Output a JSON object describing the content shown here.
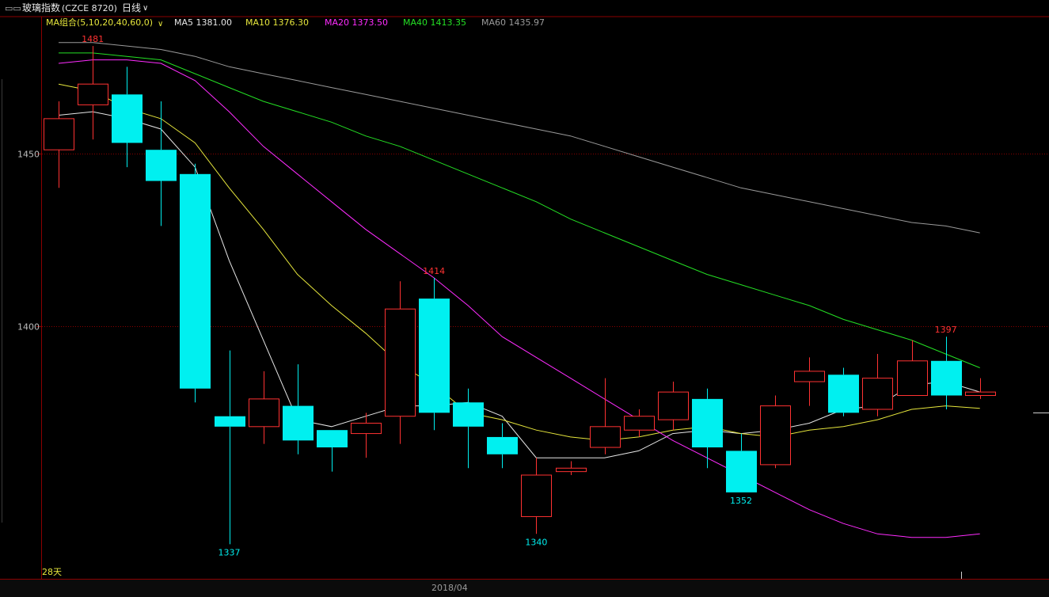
{
  "window": {
    "title_icon": "window-icon",
    "title": "玻璃指数",
    "code": "(CZCE 8720)",
    "period": "日线",
    "period_icon": "chevron-down-icon"
  },
  "ma_legend": {
    "group_label": "MA组合(5,10,20,40,60,0)",
    "group_icon": "chevron-down-icon",
    "items": [
      {
        "label": "MA5 1381.00",
        "color": "#e6e6e6"
      },
      {
        "label": "MA10 1376.30",
        "color": "#e6e63c"
      },
      {
        "label": "MA20 1373.50",
        "color": "#ff2cff"
      },
      {
        "label": "MA40 1413.35",
        "color": "#24e024"
      },
      {
        "label": "MA60 1435.97",
        "color": "#9a9a9a"
      }
    ]
  },
  "chart_data": {
    "type": "candlestick",
    "ylim": [
      1330,
      1484
    ],
    "y_ticks": [
      1450,
      1400
    ],
    "y_tick_labels": [
      "1450",
      "1400"
    ],
    "x_tick_labels": [
      "2018/04"
    ],
    "period_count_label": "28天",
    "colors": {
      "up": "#ff3232",
      "down": "#00f0f0",
      "grid": "#8b0000"
    },
    "candles": [
      {
        "open": 1451,
        "close": 1460,
        "high": 1465,
        "low": 1440
      },
      {
        "open": 1464,
        "close": 1470,
        "high": 1481,
        "low": 1454
      },
      {
        "open": 1467,
        "close": 1453,
        "high": 1475,
        "low": 1446
      },
      {
        "open": 1451,
        "close": 1442,
        "high": 1465,
        "low": 1429
      },
      {
        "open": 1444,
        "close": 1382,
        "high": 1447,
        "low": 1378
      },
      {
        "open": 1374,
        "close": 1371,
        "high": 1393,
        "low": 1337
      },
      {
        "open": 1371,
        "close": 1379,
        "high": 1387,
        "low": 1366
      },
      {
        "open": 1377,
        "close": 1367,
        "high": 1389,
        "low": 1363
      },
      {
        "open": 1370,
        "close": 1365,
        "high": 1370,
        "low": 1358
      },
      {
        "open": 1369,
        "close": 1372,
        "high": 1375,
        "low": 1362
      },
      {
        "open": 1374,
        "close": 1405,
        "high": 1413,
        "low": 1366
      },
      {
        "open": 1408,
        "close": 1375,
        "high": 1414,
        "low": 1370
      },
      {
        "open": 1378,
        "close": 1371,
        "high": 1382,
        "low": 1359
      },
      {
        "open": 1368,
        "close": 1363,
        "high": 1372,
        "low": 1359
      },
      {
        "open": 1345,
        "close": 1357,
        "high": 1362,
        "low": 1340
      },
      {
        "open": 1358,
        "close": 1359,
        "high": 1361,
        "low": 1357
      },
      {
        "open": 1365,
        "close": 1371,
        "high": 1385,
        "low": 1363
      },
      {
        "open": 1370,
        "close": 1374,
        "high": 1376,
        "low": 1368
      },
      {
        "open": 1373,
        "close": 1381,
        "high": 1384,
        "low": 1370
      },
      {
        "open": 1379,
        "close": 1365,
        "high": 1382,
        "low": 1359
      },
      {
        "open": 1364,
        "close": 1352,
        "high": 1369,
        "low": 1352
      },
      {
        "open": 1360,
        "close": 1377,
        "high": 1380,
        "low": 1359
      },
      {
        "open": 1384,
        "close": 1387,
        "high": 1391,
        "low": 1377
      },
      {
        "open": 1386,
        "close": 1375,
        "high": 1388,
        "low": 1374
      },
      {
        "open": 1376,
        "close": 1385,
        "high": 1392,
        "low": 1374
      },
      {
        "open": 1380,
        "close": 1390,
        "high": 1396,
        "low": 1380
      },
      {
        "open": 1390,
        "close": 1380,
        "high": 1397,
        "low": 1376
      },
      {
        "open": 1380,
        "close": 1381,
        "high": 1385,
        "low": 1379
      }
    ],
    "annotations": [
      {
        "index": 1,
        "value": 1481,
        "label": "1481",
        "pos": "above",
        "color": "#ff3232"
      },
      {
        "index": 5,
        "value": 1337,
        "label": "1337",
        "pos": "below",
        "color": "#00f0f0"
      },
      {
        "index": 11,
        "value": 1414,
        "label": "1414",
        "pos": "above",
        "color": "#ff3232"
      },
      {
        "index": 14,
        "value": 1340,
        "label": "1340",
        "pos": "below",
        "color": "#00f0f0"
      },
      {
        "index": 20,
        "value": 1352,
        "label": "1352",
        "pos": "below",
        "color": "#00f0f0"
      },
      {
        "index": 26,
        "value": 1397,
        "label": "1397",
        "pos": "above",
        "color": "#ff3232"
      }
    ],
    "series": [
      {
        "name": "MA5",
        "color": "#e6e6e6",
        "values": [
          1461,
          1462,
          1460,
          1457,
          1446,
          1419,
          1396,
          1373,
          1371,
          1374,
          1377,
          1377,
          1378,
          1374,
          1362,
          1362,
          1362,
          1364,
          1369,
          1370,
          1369,
          1370,
          1372,
          1376,
          1377,
          1383,
          1384,
          1381
        ]
      },
      {
        "name": "MA10",
        "color": "#e6e63c",
        "values": [
          1470,
          1468,
          1463,
          1460,
          1453,
          1440,
          1428,
          1415,
          1406,
          1398,
          1389,
          1383,
          1375,
          1373,
          1370,
          1368,
          1367,
          1368,
          1370,
          1371,
          1369,
          1368,
          1370,
          1371,
          1373,
          1376,
          1377,
          1376.3
        ]
      },
      {
        "name": "MA20",
        "color": "#ff2cff",
        "values": [
          1476,
          1477,
          1477,
          1476,
          1471,
          1462,
          1452,
          1444,
          1436,
          1428,
          1421,
          1414,
          1406,
          1397,
          1391,
          1385,
          1379,
          1373,
          1367,
          1362,
          1357,
          1352,
          1347,
          1343,
          1340,
          1339,
          1339,
          1340
        ]
      },
      {
        "name": "MA40",
        "color": "#24e024",
        "values": [
          1479,
          1479,
          1478,
          1477,
          1473,
          1469,
          1465,
          1462,
          1459,
          1455,
          1452,
          1448,
          1444,
          1440,
          1436,
          1431,
          1427,
          1423,
          1419,
          1415,
          1412,
          1409,
          1406,
          1402,
          1399,
          1396,
          1392,
          1388
        ]
      },
      {
        "name": "MA60",
        "color": "#9a9a9a",
        "values": [
          1482,
          1482,
          1481,
          1480,
          1478,
          1475,
          1473,
          1471,
          1469,
          1467,
          1465,
          1463,
          1461,
          1459,
          1457,
          1455,
          1452,
          1449,
          1446,
          1443,
          1440,
          1438,
          1436,
          1434,
          1432,
          1430,
          1429,
          1427
        ]
      }
    ]
  }
}
